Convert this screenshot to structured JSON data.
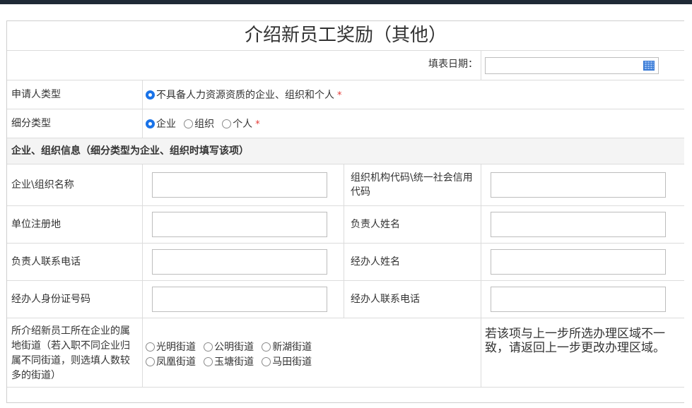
{
  "form": {
    "title": "介绍新员工奖励（其他）",
    "date_label": "填表日期：",
    "date_value": "",
    "applicant_type": {
      "label": "申请人类型",
      "option": "不具备人力资源资质的企业、组织和个人",
      "required_mark": "*"
    },
    "sub_type": {
      "label": "细分类型",
      "options": [
        "企业",
        "组织",
        "个人"
      ],
      "selected": "企业",
      "required_mark": "*"
    },
    "section_header": "企业、组织信息（细分类型为企业、组织时填写该项）",
    "fields": {
      "org_name_label": "企业\\组织名称",
      "org_code_label": "组织机构代码\\统一社会信用代码",
      "reg_place_label": "单位注册地",
      "leader_name_label": "负责人姓名",
      "leader_phone_label": "负责人联系电话",
      "agent_name_label": "经办人姓名",
      "agent_id_label": "经办人身份证号码",
      "agent_phone_label": "经办人联系电话"
    },
    "street": {
      "label": "所介绍新员工所在企业的属地街道（若入职不同企业归属不同街道，则选填人数较多的街道）",
      "options_row1": [
        "光明街道",
        "公明街道",
        "新湖街道"
      ],
      "options_row2": [
        "凤凰街道",
        "玉塘街道",
        "马田街道"
      ],
      "note": "若该项与上一步所选办理区域不一致，请返回上一步更改办理区域。"
    }
  }
}
